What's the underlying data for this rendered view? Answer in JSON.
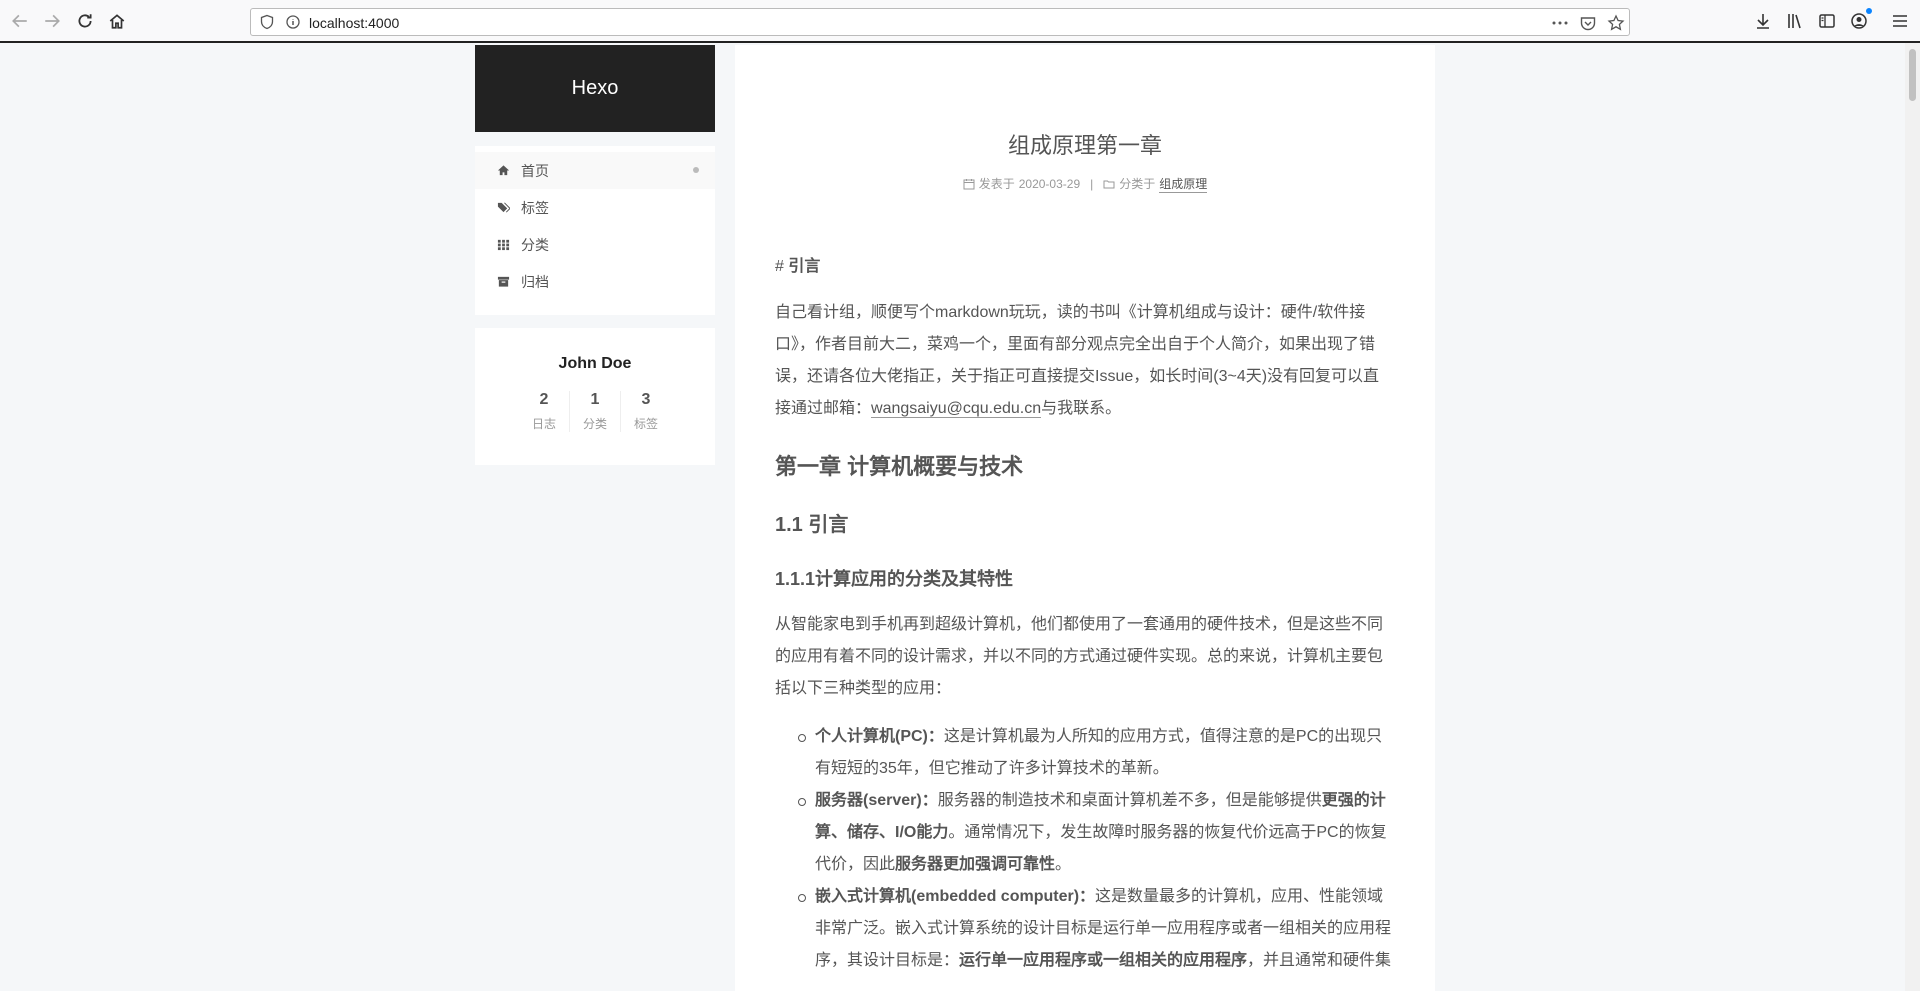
{
  "browser": {
    "url": "localhost:4000"
  },
  "site": {
    "title": "Hexo",
    "menu": [
      {
        "label": "首页",
        "icon": "home-icon",
        "active": true
      },
      {
        "label": "标签",
        "icon": "tags-icon",
        "active": false
      },
      {
        "label": "分类",
        "icon": "th-icon",
        "active": false
      },
      {
        "label": "归档",
        "icon": "archive-icon",
        "active": false
      }
    ],
    "author": "John Doe",
    "stats": [
      {
        "count": "2",
        "label": "日志"
      },
      {
        "count": "1",
        "label": "分类"
      },
      {
        "count": "3",
        "label": "标签"
      }
    ]
  },
  "post": {
    "title": "组成原理第一章",
    "meta": {
      "posted_label": "发表于",
      "date": "2020-03-29",
      "separator": "|",
      "category_label": "分类于",
      "category": "组成原理"
    },
    "quote_hash": "#",
    "quote_title": "引言",
    "intro_before": "自己看计组，顺便写个markdown玩玩，读的书叫《计算机组成与设计：硬件/软件接口》，作者目前大二，菜鸡一个，里面有部分观点完全出自于个人简介，如果出现了错误，还请各位大佬指正，关于指正可直接提交Issue，如长时间(3~4天)没有回复可以直接通过邮箱：",
    "intro_email": "wangsaiyu@cqu.edu.cn",
    "intro_after": "与我联系。",
    "chapter": "第一章 计算机概要与技术",
    "section": "1.1 引言",
    "subsection": "1.1.1计算应用的分类及其特性",
    "para2": "从智能家电到手机再到超级计算机，他们都使用了一套通用的硬件技术，但是这些不同的应用有着不同的设计需求，并以不同的方式通过硬件实现。总的来说，计算机主要包括以下三种类型的应用：",
    "items": {
      "pc_title": "个人计算机(PC)：",
      "pc_text": "这是计算机最为人所知的应用方式，值得注意的是PC的出现只有短短的35年，但它推动了许多计算技术的革新。",
      "server_title": "服务器(server)：",
      "server_text1": "服务器的制造技术和桌面计算机差不多，但是能够提供",
      "server_bold1": "更强的计算、储存、I/O能力",
      "server_text2": "。通常情况下，发生故障时服务器的恢复代价远高于PC的恢复代价，因此",
      "server_bold2": "服务器更加强调可靠性",
      "server_text3": "。",
      "embedded_title": "嵌入式计算机(embedded computer)：",
      "embedded_text1": "这是数量最多的计算机，应用、性能领域非常广泛。嵌入式计算系统的设计目标是运行单一应用程序或者一组相关的应用程序，其设计目标是：",
      "embedded_bold": "运行单一应用程序或一组相关的应用程序",
      "embedded_text2": "，并且通常和硬件集"
    }
  }
}
